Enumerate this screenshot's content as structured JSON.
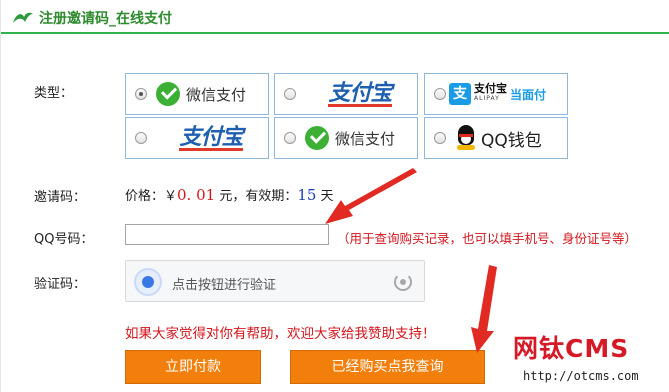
{
  "header": {
    "title": "注册邀请码_在线支付"
  },
  "labels": {
    "type": "类型：",
    "invite": "邀请码：",
    "qq": "QQ号码：",
    "captcha": "验证码："
  },
  "pay_options": [
    {
      "id": "wechat-1",
      "text": "微信支付",
      "icon": "wechat-icon",
      "selected": true
    },
    {
      "id": "alipay-1",
      "text": "支付宝",
      "icon": "alipay-logo",
      "selected": false
    },
    {
      "id": "alipay-f2f",
      "text": "支付宝",
      "sub": "ALIPAY",
      "extra": "当面付",
      "icon": "alipay-icon",
      "selected": false
    },
    {
      "id": "alipay-2",
      "text": "支付宝",
      "icon": "alipay-logo",
      "selected": false
    },
    {
      "id": "wechat-2",
      "text": "微信支付",
      "icon": "wechat-icon",
      "selected": false
    },
    {
      "id": "qq-wallet",
      "text": "QQ钱包",
      "icon": "qq-penguin-icon",
      "selected": false
    }
  ],
  "price": {
    "prefix": "价格：￥",
    "amount": "0. 01",
    "unit": " 元，有效期：",
    "days": "15",
    "suffix": " 天"
  },
  "qq_input": {
    "value": "",
    "placeholder": ""
  },
  "hint": "（用于查询购买记录，也可以填手机号、身份证号等）",
  "captcha": {
    "text": "点击按钮进行验证"
  },
  "thanks": "如果大家觉得对你有帮助，欢迎大家给我赞助支持！",
  "buttons": {
    "pay": "立即付款",
    "query": "已经购买点我查询"
  },
  "watermark": {
    "title": "网钛CMS",
    "url": "http://otcms.com"
  },
  "colors": {
    "header_line": "#2fb34a",
    "button": "#f27f0c",
    "accent_red": "#d4161c",
    "border_blue": "#8fb8dc"
  }
}
